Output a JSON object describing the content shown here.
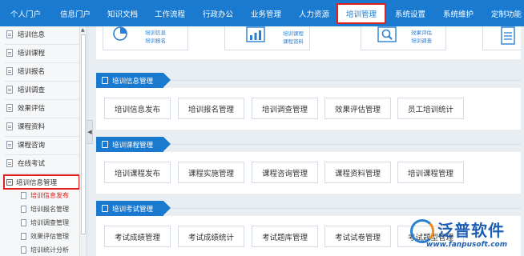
{
  "topnav": {
    "items": [
      "个人门户",
      "信息门户",
      "知识文档",
      "工作流程",
      "行政办公",
      "业务管理",
      "人力资源",
      "培训管理",
      "系统设置",
      "系统维护",
      "定制功能"
    ],
    "active_index": 7
  },
  "sidebar": {
    "items": [
      "培训信息",
      "培训课程",
      "培训报名",
      "培训调查",
      "效果评估",
      "课程资料",
      "课程咨询",
      "在线考试"
    ],
    "group_label": "培训信息管理",
    "sub_items": [
      "培训信息发布",
      "培训报名管理",
      "培训调查管理",
      "效果评估管理",
      "培训统计分析"
    ],
    "active_sub_index": 0,
    "collapse_arrow": "◀"
  },
  "quick_links": [
    {
      "icon": "pie-chart-icon",
      "lines": [
        "培训信息",
        "培训报名"
      ]
    },
    {
      "icon": "bar-chart-icon",
      "lines": [
        "培训课程",
        "课程资料"
      ]
    },
    {
      "icon": "magnifier-icon",
      "lines": [
        "效果评估",
        "培训调查"
      ]
    },
    {
      "icon": "document-icon",
      "lines": [
        "",
        ""
      ]
    }
  ],
  "sections": [
    {
      "title": "培训信息管理",
      "buttons": [
        "培训信息发布",
        "培训报名管理",
        "培训调查管理",
        "效果评估管理",
        "员工培训统计"
      ]
    },
    {
      "title": "培训课程管理",
      "buttons": [
        "培训课程发布",
        "课程实施管理",
        "课程咨询管理",
        "课程资料管理",
        "培训课程管理"
      ]
    },
    {
      "title": "培训考试管理",
      "buttons": [
        "考试成绩管理",
        "考试成绩统计",
        "考试题库管理",
        "考试试卷管理",
        "考试题型管理"
      ]
    }
  ],
  "logo": {
    "name": "泛普软件",
    "url": "www.fanpusoft.com"
  },
  "colors": {
    "brand_blue": "#1a7ad0",
    "highlight_red": "#e0201b",
    "logo_orange": "#f08a1c"
  }
}
